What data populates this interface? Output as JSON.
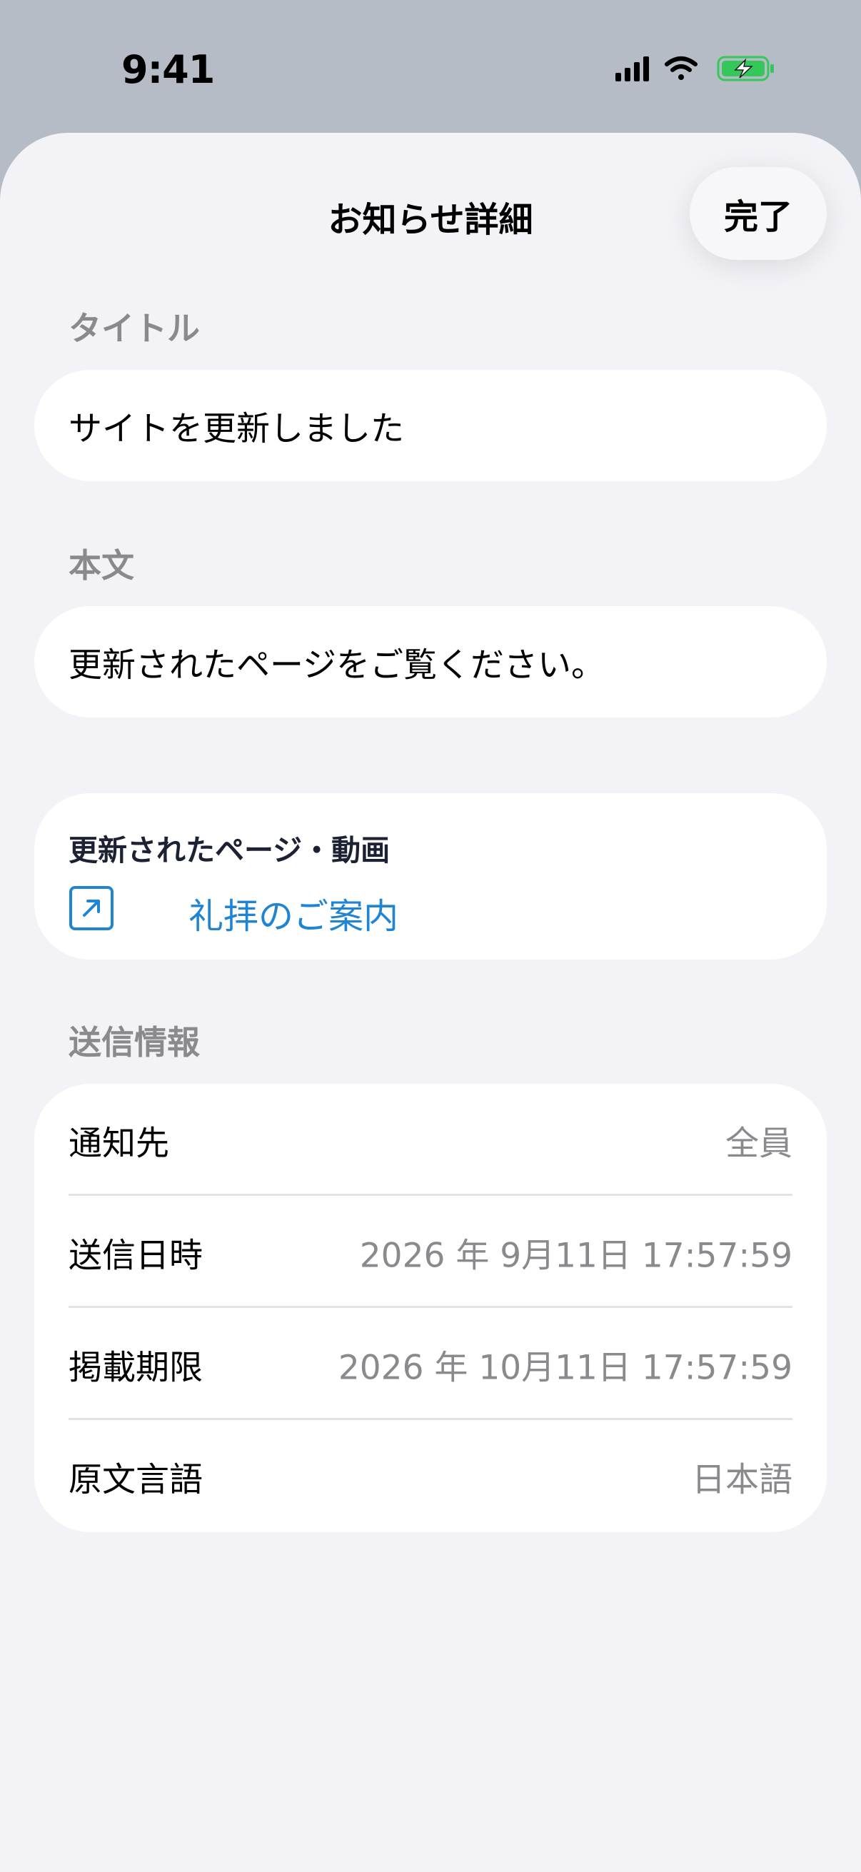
{
  "status_bar": {
    "time": "9:41",
    "icons": [
      "cellular-signal-icon",
      "wifi-icon",
      "battery-charging-icon"
    ],
    "battery_color": "#34c759"
  },
  "header": {
    "title": "お知らせ詳細",
    "done_label": "完了"
  },
  "title_section": {
    "label": "タイトル",
    "value": "サイトを更新しました"
  },
  "body_section": {
    "label": "本文",
    "value": "更新されたページをご覧ください。"
  },
  "links_section": {
    "heading": "更新されたページ・動画",
    "items": [
      {
        "icon": "external-link-icon",
        "label": "礼拝のご案内"
      }
    ],
    "link_color": "#1f84d4"
  },
  "send_info": {
    "label": "送信情報",
    "rows": [
      {
        "key": "通知先",
        "value": "全員"
      },
      {
        "key": "送信日時",
        "value": "2026 年 9月11日 17:57:59"
      },
      {
        "key": "掲載期限",
        "value": "2026 年 10月11日 17:57:59"
      },
      {
        "key": "原文言語",
        "value": "日本語"
      }
    ]
  }
}
